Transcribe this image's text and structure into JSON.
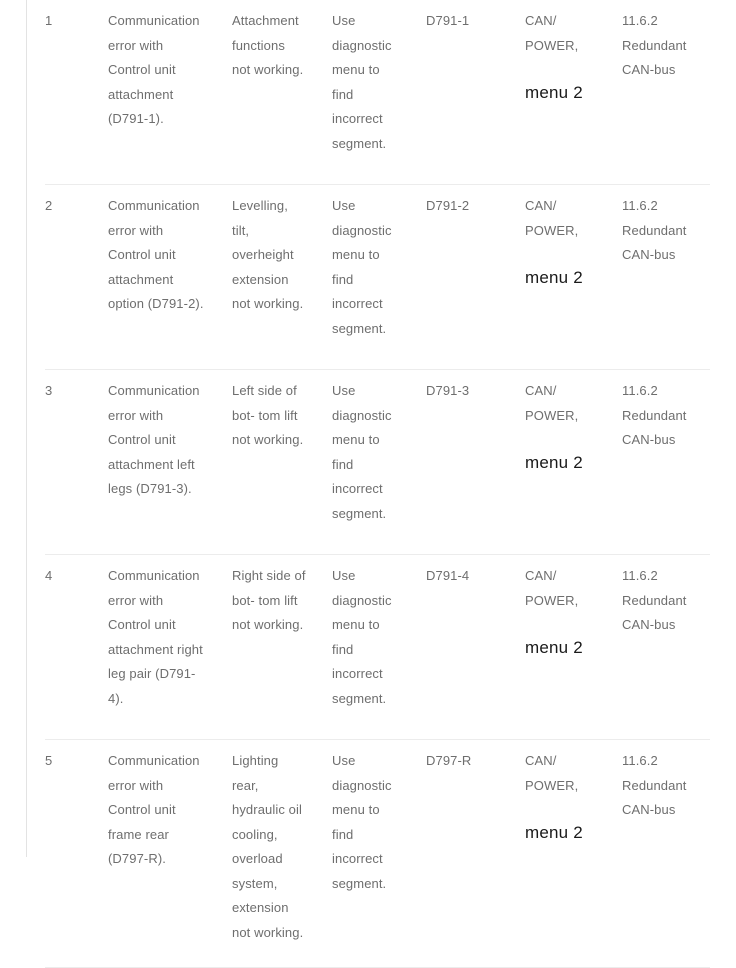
{
  "table": {
    "name": "fault-code-table",
    "columns": [
      {
        "key": "num",
        "name": "row-number"
      },
      {
        "key": "desc",
        "name": "fault-description"
      },
      {
        "key": "symptom",
        "name": "symptom"
      },
      {
        "key": "action",
        "name": "corrective-action"
      },
      {
        "key": "code",
        "name": "fault-code"
      },
      {
        "key": "system",
        "name": "system"
      },
      {
        "key": "ref",
        "name": "reference"
      }
    ],
    "rows": [
      {
        "num": "1",
        "desc": "Communication error with Control unit attachment (D791-1).",
        "desc_lines": [
          "Communication",
          "error with",
          "Control unit",
          "attachment",
          "(D791-1)."
        ],
        "symptom": "Attachment functions not working.",
        "symptom_lines": [
          "Attachment",
          "functions",
          "not working."
        ],
        "action": "Use diagnostic menu to find incorrect segment.",
        "action_lines": [
          "Use",
          "diagnostic",
          "menu to",
          "find",
          "incorrect",
          "segment."
        ],
        "code": "D791-1",
        "system": "CAN/ POWER,",
        "system_lines": [
          "CAN/",
          "POWER,"
        ],
        "system_callout": "menu 2",
        "ref": "11.6.2 Redundant CAN-bus",
        "ref_lines": [
          "11.6.2",
          "Redundant",
          "CAN-bus"
        ]
      },
      {
        "num": "2",
        "desc": "Communication error with Control unit attachment option (D791-2).",
        "desc_lines": [
          "Communication",
          "error with",
          "Control unit",
          "attachment",
          "option (D791-2)."
        ],
        "symptom": "Levelling, tilt, overheight extension not working.",
        "symptom_lines": [
          "Levelling,",
          "tilt,",
          "overheight",
          "extension",
          "not working."
        ],
        "action": "Use diagnostic menu to find incorrect segment.",
        "action_lines": [
          "Use",
          "diagnostic",
          "menu to",
          "find",
          "incorrect",
          "segment."
        ],
        "code": "D791-2",
        "system": "CAN/ POWER,",
        "system_lines": [
          "CAN/",
          "POWER,"
        ],
        "system_callout": "menu 2",
        "ref": "11.6.2 Redundant CAN-bus",
        "ref_lines": [
          "11.6.2",
          "Redundant",
          "CAN-bus"
        ]
      },
      {
        "num": "3",
        "desc": "Communication error with Control unit attachment left legs (D791-3).",
        "desc_lines": [
          "Communication",
          "error with",
          "Control unit",
          "attachment left",
          "legs (D791-3)."
        ],
        "symptom": "Left side of bot- tom lift not working.",
        "symptom_lines": [
          "Left side of",
          "bot- tom lift",
          "not working."
        ],
        "action": "Use diagnostic menu to find incorrect segment.",
        "action_lines": [
          "Use",
          "diagnostic",
          "menu to",
          "find",
          "incorrect",
          "segment."
        ],
        "code": "D791-3",
        "system": "CAN/ POWER,",
        "system_lines": [
          "CAN/",
          "POWER,"
        ],
        "system_callout": "menu 2",
        "ref": "11.6.2 Redundant CAN-bus",
        "ref_lines": [
          "11.6.2",
          "Redundant",
          "CAN-bus"
        ]
      },
      {
        "num": "4",
        "desc": "Communication error with Control unit attachment right leg pair (D791-4).",
        "desc_lines": [
          "Communication",
          "error with",
          "Control unit",
          "attachment right",
          "leg pair (D791-",
          "4)."
        ],
        "symptom": "Right side of bot- tom lift not working.",
        "symptom_lines": [
          "Right side of",
          "bot- tom lift",
          "not working."
        ],
        "action": "Use diagnostic menu to find incorrect segment.",
        "action_lines": [
          "Use",
          "diagnostic",
          "menu to",
          "find",
          "incorrect",
          "segment."
        ],
        "code": "D791-4",
        "system": "CAN/ POWER,",
        "system_lines": [
          "CAN/",
          "POWER,"
        ],
        "system_callout": "menu 2",
        "ref": "11.6.2 Redundant CAN-bus",
        "ref_lines": [
          "11.6.2",
          "Redundant",
          "CAN-bus"
        ]
      },
      {
        "num": "5",
        "desc": "Communication error with Control unit frame rear (D797-R).",
        "desc_lines": [
          "Communication",
          "error with",
          "Control unit",
          "frame rear",
          "(D797-R)."
        ],
        "symptom": "Lighting rear, hydraulic oil cooling, overload system, extension not working.",
        "symptom_lines": [
          "Lighting",
          "rear,",
          "hydraulic oil",
          "cooling,",
          "overload",
          "system,",
          "extension",
          "not working."
        ],
        "action": "Use diagnostic menu to find incorrect segment.",
        "action_lines": [
          "Use",
          "diagnostic",
          "menu to",
          "find",
          "incorrect",
          "segment."
        ],
        "code": "D797-R",
        "system": "CAN/ POWER,",
        "system_lines": [
          "CAN/",
          "POWER,"
        ],
        "system_callout": "menu 2",
        "ref": "11.6.2 Redundant CAN-bus",
        "ref_lines": [
          "11.6.2",
          "Redundant",
          "CAN-bus"
        ]
      }
    ]
  },
  "style": {
    "text_color": "#6e6e6e",
    "callout_color": "#1a1a1a",
    "divider_color": "#ececec",
    "rule_color": "#e3e3e3",
    "background": "#ffffff"
  }
}
